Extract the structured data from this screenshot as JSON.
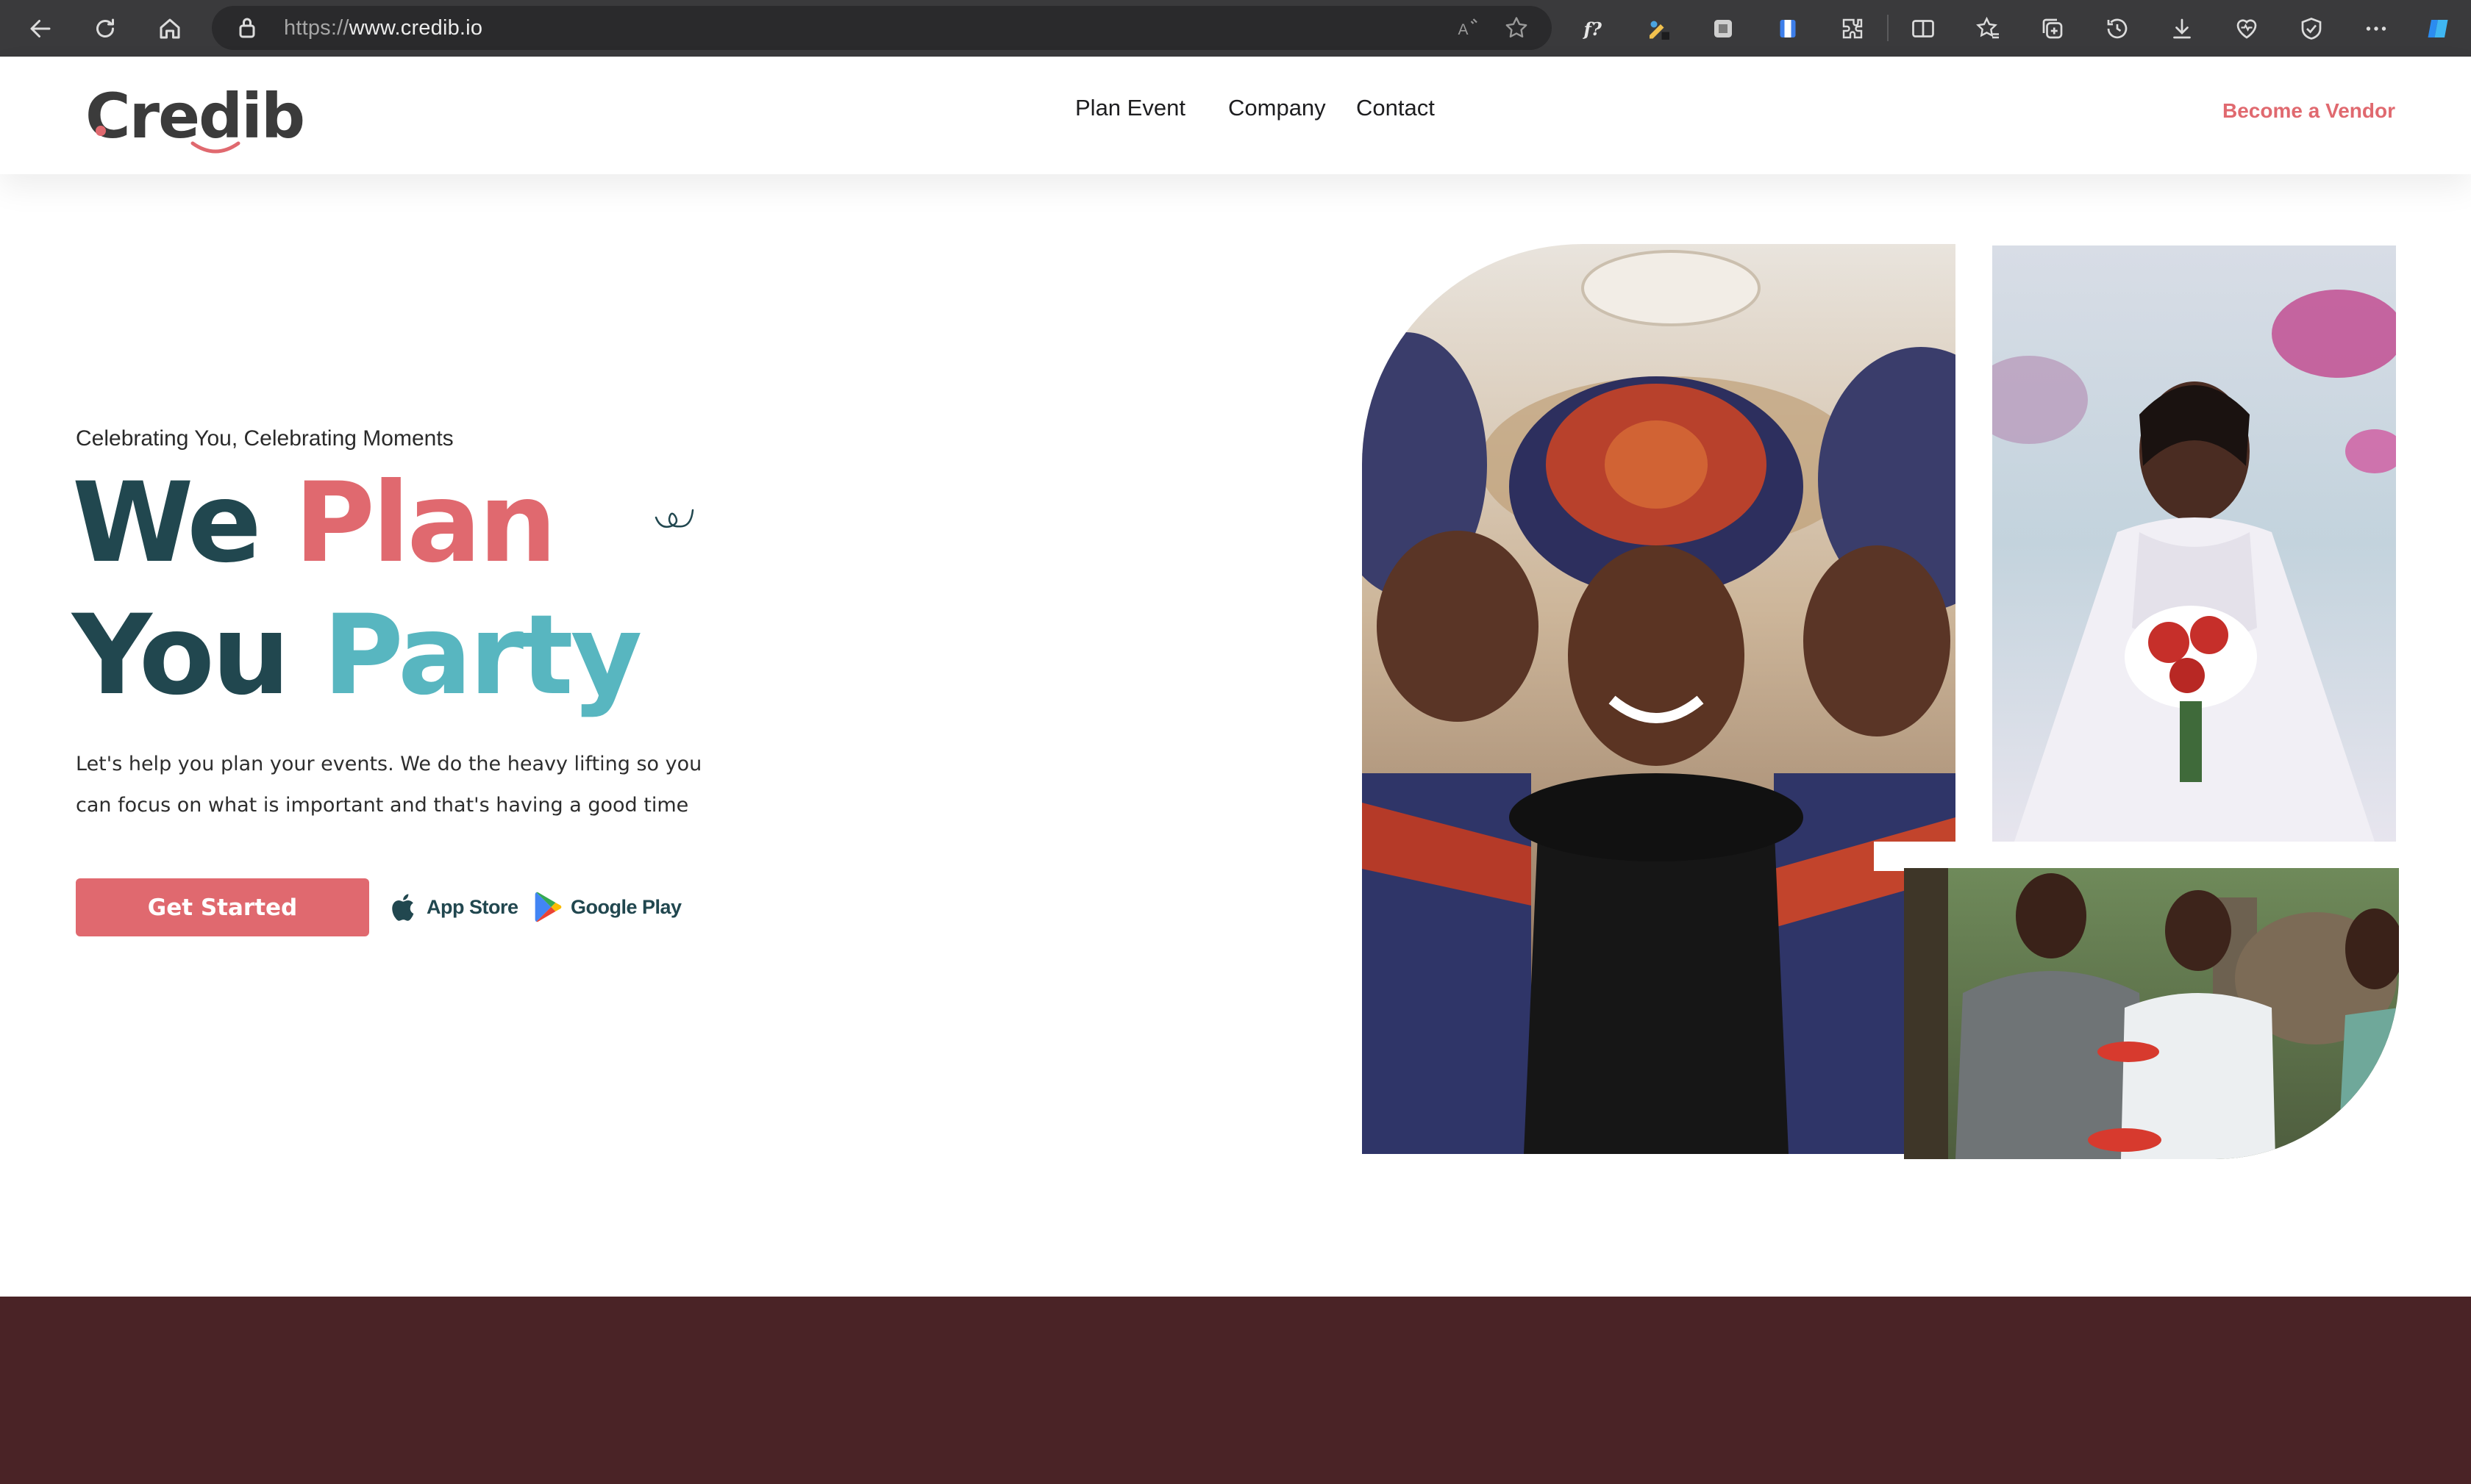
{
  "browser": {
    "url_protocol": "https://",
    "url_host": "www.credib.io",
    "icons": [
      "back-icon",
      "reload-icon",
      "home-icon",
      "lock-icon",
      "read-aloud-icon",
      "favorite-star-icon",
      "formula-extension-icon",
      "color-picker-extension-icon",
      "screenshot-extension-icon",
      "bookmark-extension-icon",
      "extensions-puzzle-icon",
      "split-screen-icon",
      "favorites-icon",
      "collections-icon",
      "history-icon",
      "downloads-icon",
      "performance-icon",
      "browser-essentials-icon",
      "more-icon",
      "copilot-icon"
    ]
  },
  "header": {
    "logo_text": "Credib",
    "nav": [
      "Plan Event",
      "Company",
      "Contact"
    ],
    "vendor_link": "Become a Vendor"
  },
  "hero": {
    "tagline": "Celebrating You, Celebrating Moments",
    "line1_word1": "We",
    "line1_word2": "Plan",
    "line2_word1": "You",
    "line2_word2": "Party",
    "description_line1": "Let's help you plan your events. We do the heavy lifting so you",
    "description_line2": "can focus on what is important and that's having a good time",
    "cta_label": "Get Started",
    "app_store_label": "App Store",
    "google_play_label": "Google Play"
  },
  "colors": {
    "brand_coral": "#e0696f",
    "brand_teal": "#58b6c0",
    "brand_dark": "#21474f",
    "footer_band": "#4a2326"
  }
}
